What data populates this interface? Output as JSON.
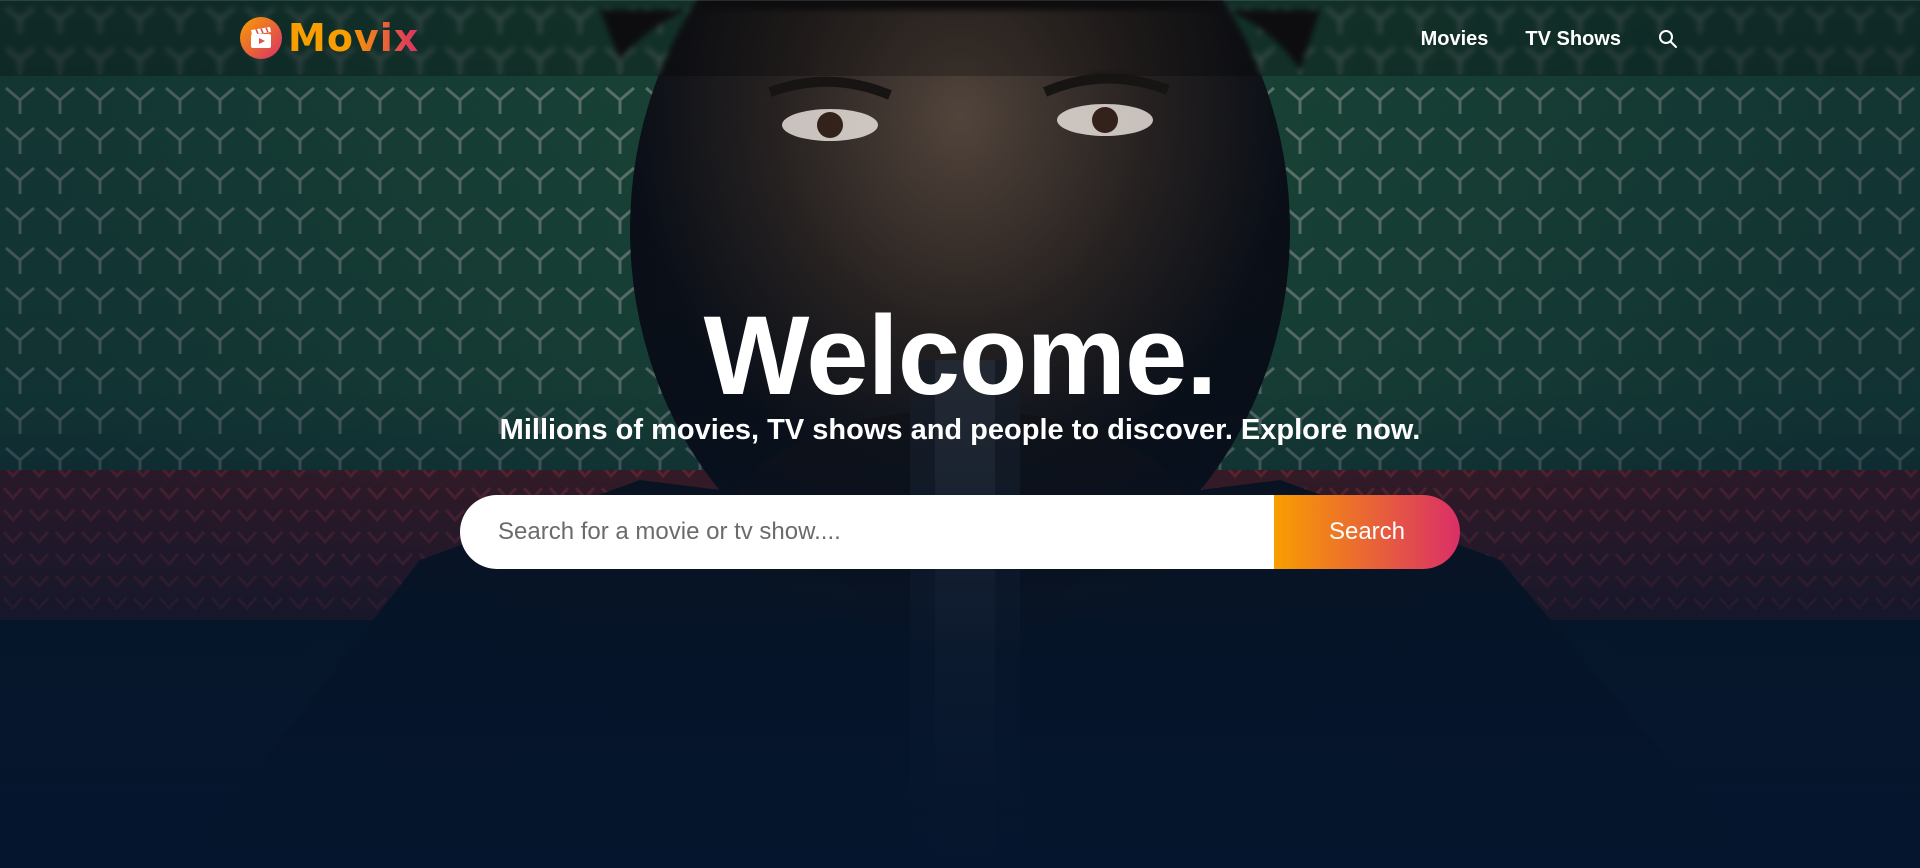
{
  "header": {
    "logo_text": "Movix",
    "nav": [
      {
        "label": "Movies"
      },
      {
        "label": "TV Shows"
      }
    ],
    "search_icon": "search-icon"
  },
  "hero": {
    "title": "Welcome.",
    "subtitle": "Millions of movies, TV shows and people to discover. Explore now.",
    "search": {
      "placeholder": "Search for a movie or tv show....",
      "value": "",
      "button_label": "Search"
    }
  },
  "colors": {
    "background": "#04152d",
    "accent_orange": "#f89e00",
    "accent_pink": "#da2f68",
    "text": "#ffffff"
  },
  "icons": {
    "logo": "film-clapper-icon",
    "search": "search-icon"
  }
}
